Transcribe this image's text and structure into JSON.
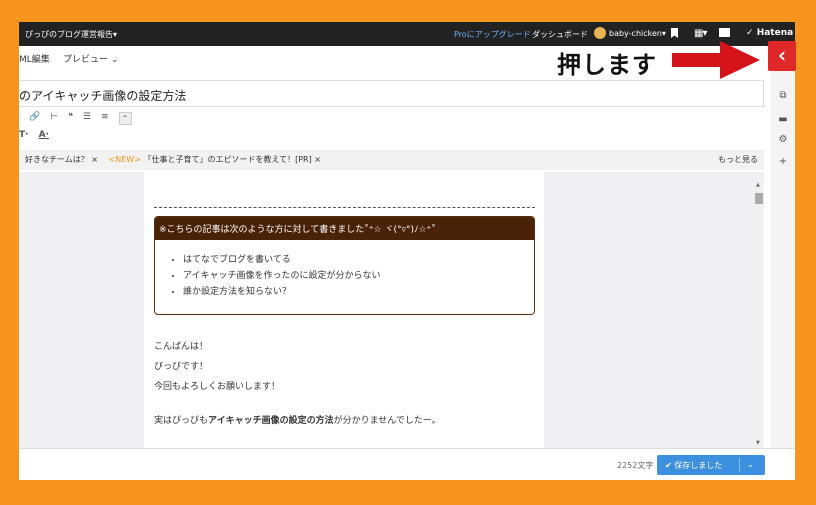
{
  "topbar": {
    "blog_title": "ぴっぴのブログ運営報告▾",
    "pro_link": "Proにアップグレード",
    "dashboard": "ダッシュボード",
    "username": "baby-chicken▾",
    "grid_label": "▾",
    "hatena": "Hatena"
  },
  "tabs": {
    "html_edit": "ML編集",
    "preview": "プレビュー ⌄"
  },
  "title": "のアイキャッチ画像の設定方法",
  "toolbar": {
    "text_style": "T·",
    "text_color": "A·",
    "collapse": "⌃"
  },
  "topics": {
    "t1": "好きなチームは？ ×",
    "new_badge": "<NEW>",
    "t2": "「仕事と子育て」のエピソードを教えて！[PR] ×",
    "more": "もっと見る"
  },
  "doc": {
    "callout_title": "※こちらの記事は次のような方に対して書きました˚⁺☆ ヾ(°▿°)ﾉ☆⁺˚",
    "bullets": [
      "はてなでブログを書いてる",
      "アイキャッチ画像を作ったのに設定が分からない",
      "誰か設定方法を知らない？"
    ],
    "lines": [
      "こんばんは！",
      "ぴっぴです！",
      "今回もよろしくお願いします！"
    ],
    "para_pre": "実はぴっぴも",
    "para_bold": "アイキャッチ画像の設定の方法",
    "para_post": "が分かりませんでしたー。"
  },
  "footer": {
    "char_count": "2252文字",
    "save_label": "✔ 保存しました",
    "save_caret": "⌄"
  },
  "annotation": {
    "text": "押します",
    "highlight_glyph": "‹"
  },
  "colors": {
    "accent": "#f7941d",
    "save": "#3d8fe0",
    "highlight": "#e02828"
  }
}
